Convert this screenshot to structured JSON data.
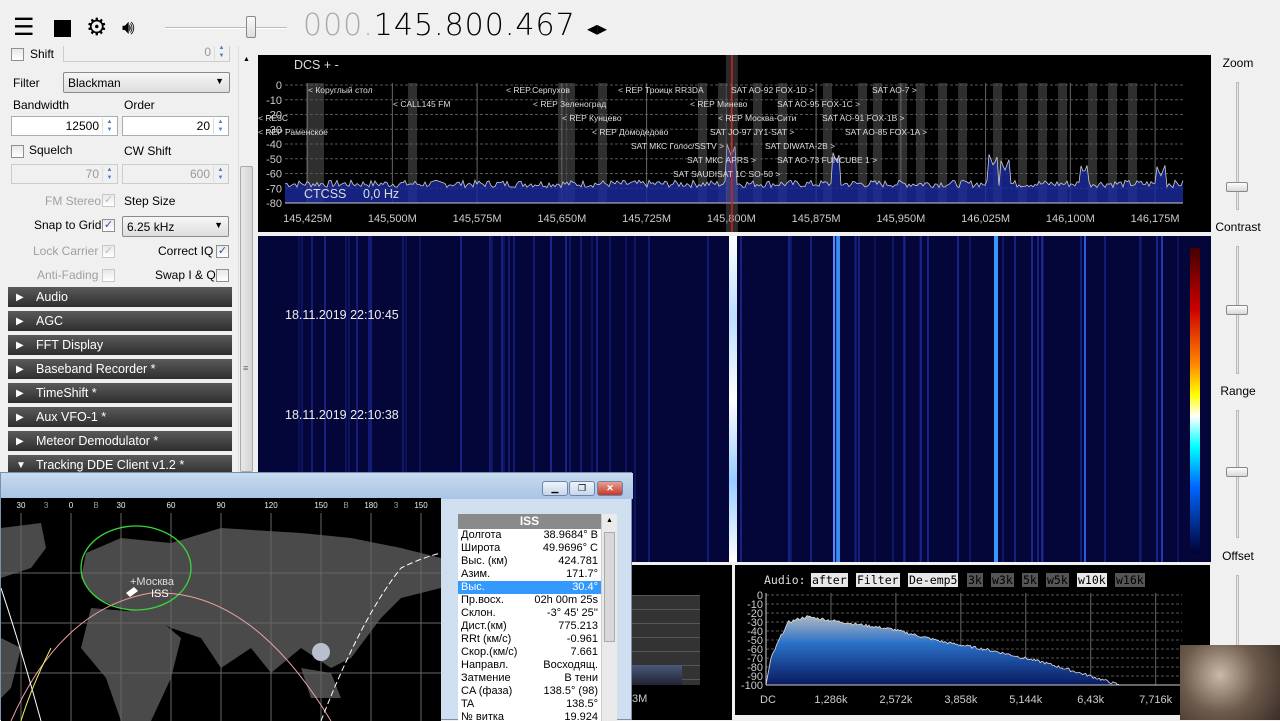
{
  "toolbar": {
    "menu_icon": "hamburger-menu-icon",
    "stop_icon": "stop-icon",
    "settings_icon": "gear-icon",
    "volume_icon": "speaker-icon",
    "volume_level": 0.7,
    "frequency_prefix": "000.",
    "frequency": "145.800.467",
    "tune_arrows_icon": "left-right-arrows-icon"
  },
  "left_panel": {
    "shift_label": "Shift",
    "shift_value": "0",
    "filter_label": "Filter",
    "filter_value": "Blackman",
    "bandwidth_label": "Bandwidth",
    "bandwidth_value": "12500",
    "order_label": "Order",
    "order_value": "20",
    "squelch_label": "Squelch",
    "squelch_value": "70",
    "squelch_checked": false,
    "cw_shift_label": "CW Shift",
    "cw_shift_value": "600",
    "fm_stereo_label": "FM Stereo",
    "step_size_label": "Step Size",
    "snap_label": "Snap to Grid",
    "step_value": "6.25 kHz",
    "lock_carrier_label": "Lock Carrier",
    "correct_iq_label": "Correct IQ",
    "anti_fading_label": "Anti-Fading",
    "swap_iq_label": "Swap I & Q",
    "sections": [
      {
        "label": "Audio",
        "expanded": false
      },
      {
        "label": "AGC",
        "expanded": false
      },
      {
        "label": "FFT Display",
        "expanded": false
      },
      {
        "label": "Baseband Recorder *",
        "expanded": false
      },
      {
        "label": "TimeShift *",
        "expanded": false
      },
      {
        "label": "Aux VFO-1 *",
        "expanded": false
      },
      {
        "label": "Meteor Demodulator *",
        "expanded": false
      },
      {
        "label": "Tracking DDE Client v1.2 *",
        "expanded": true
      }
    ]
  },
  "spectrum": {
    "dcs_label": "DCS +  -",
    "ctcss_label": "CTCSS",
    "ctcss_value": "0,0 Hz",
    "y_ticks": [
      "0",
      "-10",
      "-20",
      "-30",
      "-40",
      "-50",
      "-60",
      "-70",
      "-80"
    ],
    "x_ticks": [
      "145,425M",
      "145,500M",
      "145,575M",
      "145,650M",
      "145,725M",
      "145,800M",
      "145,875M",
      "145,950M",
      "146,025M",
      "146,100M",
      "146,175M"
    ],
    "center_mhz": 145.800467,
    "noise_floor_db": -67,
    "peaks": [
      {
        "mhz": 145.893,
        "db": -52
      },
      {
        "mhz": 146.032,
        "db": -55
      },
      {
        "mhz": 146.042,
        "db": -58
      },
      {
        "mhz": 146.112,
        "db": -60
      },
      {
        "mhz": 146.18,
        "db": -62
      },
      {
        "mhz": 145.8,
        "db": -48
      }
    ],
    "station_labels": [
      "< Коруглый стол",
      "< CALL145 FM",
      "< REP.Серпухов",
      "< REP Зеленоград",
      "< REP Кунцево",
      "< REP Домодедово",
      "< REP Троицк RR3DA",
      "< REP Минево",
      "< REP Москва-Сити",
      "SAT AO-92 FOX-1D >",
      "SAT AO-95 FOX-1C >",
      "SAT AO-91 FOX-1B >",
      "SAT AO-85 FOX-1A >",
      "SAT AO-7 >",
      "SAT JO-97 JY1-SAT >",
      "SAT МКС Голос/SSTV >",
      "SAT DIWATA-2B >",
      "SAT МКС APRS >",
      "SAT AO-73 FUNCUBE 1 >",
      "SAT SAUDISAT 1C SO-50 >",
      "< REP Раменское",
      "< RE3C"
    ]
  },
  "waterfall": {
    "timestamps": [
      "18.11.2019 22:10:45",
      "18.11.2019 22:10:38"
    ]
  },
  "right_panel": {
    "zoom_label": "Zoom",
    "contrast_label": "Contrast",
    "range_label": "Range",
    "offset_label": "Offset",
    "zoom_level": 0.1,
    "contrast_level": 0.55,
    "range_level": 0.45
  },
  "tracking": {
    "map_lon_labels": [
      "30",
      "З",
      "0",
      "В",
      "30",
      "60",
      "90",
      "120",
      "150",
      "В",
      "180",
      "З",
      "150"
    ],
    "city_label": "+Москва",
    "sat_label": "ISS",
    "table_title": "ISS",
    "rows": [
      {
        "k": "Долгота",
        "v": "38.9684° В"
      },
      {
        "k": "Широта",
        "v": "49.9696° С"
      },
      {
        "k": "Выс. (км)",
        "v": "424.781"
      },
      {
        "k": "Азим.",
        "v": "171.7°"
      },
      {
        "k": "Выс.",
        "v": "30.4°",
        "selected": true
      },
      {
        "k": "Пр.восх.",
        "v": "02h 00m 25s"
      },
      {
        "k": "Склон.",
        "v": "-3° 45' 25''"
      },
      {
        "k": "Дист.(км)",
        "v": "775.213"
      },
      {
        "k": "RRt (км/с)",
        "v": "-0.961"
      },
      {
        "k": "Скор.(км/с)",
        "v": "7.661"
      },
      {
        "k": "Направл.",
        "v": "Восходящ."
      },
      {
        "k": "Затмение",
        "v": "В тени"
      },
      {
        "k": "CA (фаза)",
        "v": "138.5° (98)"
      },
      {
        "k": "TA",
        "v": "138.5°"
      },
      {
        "k": "№ витка",
        "v": "19.924"
      }
    ]
  },
  "mid_panel": {
    "axis_label": "3M"
  },
  "audio": {
    "title": "Audio:",
    "buttons": [
      {
        "label": "after",
        "active": true
      },
      {
        "label": "Filter",
        "active": true
      },
      {
        "label": "De-emp5",
        "active": true
      },
      {
        "label": "3k",
        "active": false
      },
      {
        "label": "w3k",
        "active": false
      },
      {
        "label": "5k",
        "active": false
      },
      {
        "label": "w5k",
        "active": false
      },
      {
        "label": "w10k",
        "active": true
      },
      {
        "label": "w16k",
        "active": false
      }
    ],
    "y_ticks": [
      "0",
      "-10",
      "-20",
      "-30",
      "-40",
      "-50",
      "-60",
      "-70",
      "-80",
      "-90",
      "-100"
    ],
    "x_ticks": [
      "DC",
      "1,286k",
      "2,572k",
      "3,858k",
      "5,144k",
      "6,43k",
      "7,716k"
    ],
    "envelope_khz_db": [
      [
        0,
        -100
      ],
      [
        0.1,
        -70
      ],
      [
        0.3,
        -45
      ],
      [
        0.45,
        -30
      ],
      [
        0.8,
        -24
      ],
      [
        1.5,
        -30
      ],
      [
        2.5,
        -38
      ],
      [
        3.5,
        -52
      ],
      [
        4.5,
        -62
      ],
      [
        5.5,
        -75
      ],
      [
        6.3,
        -88
      ],
      [
        7.0,
        -100
      ]
    ]
  },
  "colors": {
    "accent_selection": "#3399ff",
    "tuner_line": "#d42020",
    "spectrum_fill": "#1a2aa0"
  }
}
